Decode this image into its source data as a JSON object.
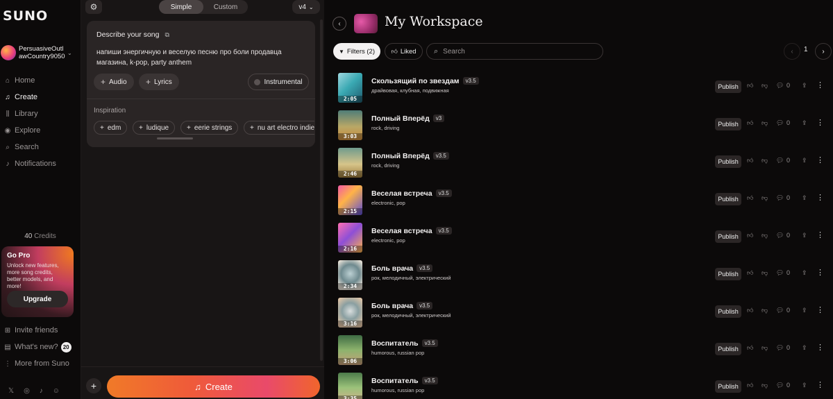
{
  "sidebar": {
    "logo": "SUNO",
    "profile_name": "PersuasiveOutlawCountry9050",
    "nav": [
      {
        "label": "Home",
        "icon": "home-icon",
        "glyph": "⌂"
      },
      {
        "label": "Create",
        "icon": "music-note-icon",
        "glyph": "♫"
      },
      {
        "label": "Library",
        "icon": "library-icon",
        "glyph": "⫼"
      },
      {
        "label": "Explore",
        "icon": "compass-icon",
        "glyph": "◉"
      },
      {
        "label": "Search",
        "icon": "search-icon",
        "glyph": "⌕"
      },
      {
        "label": "Notifications",
        "icon": "bell-icon",
        "glyph": "♪"
      }
    ],
    "credits_value": "40",
    "credits_label": "Credits",
    "gopro": {
      "title": "Go Pro",
      "text": "Unlock new features, more song credits, better models, and more!",
      "button": "Upgrade"
    },
    "bottom_nav": [
      {
        "label": "Invite friends",
        "icon": "gift-icon",
        "glyph": "⊞"
      },
      {
        "label": "What's new?",
        "icon": "news-icon",
        "glyph": "▤"
      },
      {
        "label": "More from Suno",
        "icon": "more-vertical-icon",
        "glyph": "⋮"
      }
    ],
    "whats_new_badge": "20"
  },
  "composer": {
    "modes": [
      "Simple",
      "Custom"
    ],
    "active_mode": "Simple",
    "version": "v4",
    "describe_label": "Describe your song",
    "prompt": "напиши энергичную и веселую песню про боли продавца магазина, k-pop, party anthem",
    "audio_label": "Audio",
    "lyrics_label": "Lyrics",
    "instrumental_label": "Instrumental",
    "inspiration_label": "Inspiration",
    "inspiration": [
      "edm",
      "ludique",
      "eerie strings",
      "nu art electro indie"
    ],
    "create_label": "Create"
  },
  "workspace": {
    "title": "My Workspace",
    "filters_label": "Filters (2)",
    "liked_label": "Liked",
    "search_placeholder": "Search",
    "page": "1",
    "publish_label": "Publish",
    "songs": [
      {
        "title": "Скользящий по звездам",
        "version": "v3.5",
        "tags": "драйвовая, клубная, подвижная",
        "duration": "2:05",
        "likes": "0"
      },
      {
        "title": "Полный Вперёд",
        "version": "v3",
        "tags": "rock, driving",
        "duration": "3:03",
        "likes": "0"
      },
      {
        "title": "Полный Вперёд",
        "version": "v3.5",
        "tags": "rock, driving",
        "duration": "2:46",
        "likes": "0"
      },
      {
        "title": "Веселая встреча",
        "version": "v3.5",
        "tags": "electronic, pop",
        "duration": "2:15",
        "likes": "0"
      },
      {
        "title": "Веселая встреча",
        "version": "v3.5",
        "tags": "electronic, pop",
        "duration": "2:16",
        "likes": "0"
      },
      {
        "title": "Боль врача",
        "version": "v3.5",
        "tags": "рок, мелодичный, электрический",
        "duration": "2:34",
        "likes": "0"
      },
      {
        "title": "Боль врача",
        "version": "v3.5",
        "tags": "рок, мелодичный, электрический",
        "duration": "3:16",
        "likes": "0"
      },
      {
        "title": "Воспитатель",
        "version": "v3.5",
        "tags": "humorous, russian pop",
        "duration": "3:06",
        "likes": "0"
      },
      {
        "title": "Воспитатель",
        "version": "v3.5",
        "tags": "humorous, russian pop",
        "duration": "3:35",
        "likes": "0"
      }
    ]
  }
}
